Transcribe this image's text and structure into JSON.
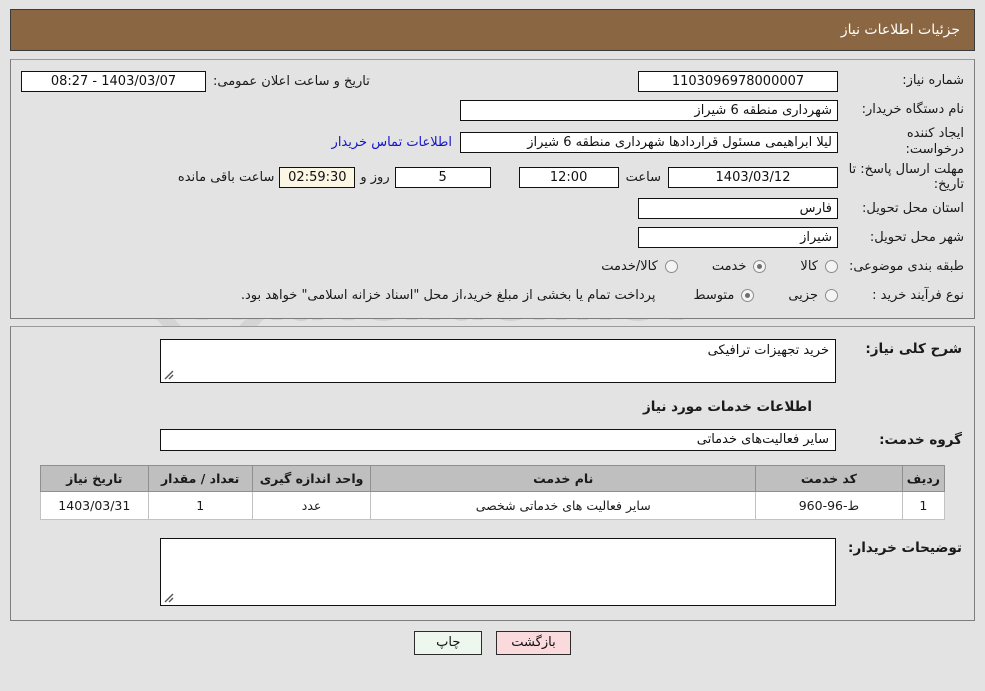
{
  "header": {
    "title": "جزئیات اطلاعات نیاز"
  },
  "watermark": {
    "text": "AnaTender.net"
  },
  "top_form": {
    "need_number": {
      "label": "شماره نیاز:",
      "value": "1103096978000007"
    },
    "public_announce": {
      "label": "تاریخ و ساعت اعلان عمومی:",
      "value": "1403/03/07 - 08:27"
    },
    "buyer_org": {
      "label": "نام دستگاه خریدار:",
      "value": "شهرداری منطقه 6 شیراز"
    },
    "request_creator": {
      "label": "ایجاد کننده درخواست:",
      "value": "لیلا ابراهیمی مسئول قراردادها شهرداری منطقه 6 شیراز"
    },
    "contact_link": "اطلاعات تماس خریدار",
    "deadline": {
      "label": "مهلت ارسال پاسخ: تا تاریخ:",
      "date": "1403/03/12",
      "time_label": "ساعت",
      "time": "12:00",
      "days": "5",
      "days_label": "روز و",
      "countdown": "02:59:30",
      "countdown_label": "ساعت باقی مانده"
    },
    "province": {
      "label": "استان محل تحویل:",
      "value": "فارس"
    },
    "city": {
      "label": "شهر محل تحویل:",
      "value": "شیراز"
    },
    "category": {
      "label": "طبقه بندی موضوعی:",
      "options": [
        {
          "label": "کالا",
          "selected": false
        },
        {
          "label": "خدمت",
          "selected": true
        },
        {
          "label": "کالا/خدمت",
          "selected": false
        }
      ]
    },
    "process_type": {
      "label": "نوع فرآیند خرید :",
      "options": [
        {
          "label": "جزیی",
          "selected": false
        },
        {
          "label": "متوسط",
          "selected": true
        }
      ],
      "note": "پرداخت تمام یا بخشی از مبلغ خرید،از محل \"اسناد خزانه اسلامی\" خواهد بود."
    }
  },
  "middle": {
    "general_desc": {
      "label": "شرح کلی نیاز:",
      "value": "خرید تجهیزات ترافیکی"
    },
    "services_section_title": "اطلاعات خدمات مورد نیاز",
    "service_group": {
      "label": "گروه خدمت:",
      "value": "سایر فعالیت‌های خدماتی"
    },
    "table": {
      "columns": [
        "ردیف",
        "کد خدمت",
        "نام خدمت",
        "واحد اندازه گیری",
        "تعداد / مقدار",
        "تاریخ نیاز"
      ],
      "rows": [
        {
          "radif": "1",
          "code": "ط-96-960",
          "name": "سایر فعالیت های خدماتی شخصی",
          "unit": "عدد",
          "qty": "1",
          "date": "1403/03/31"
        }
      ]
    },
    "buyer_comments": {
      "label": "توضیحات خریدار:",
      "value": ""
    }
  },
  "footer": {
    "print_label": "چاپ",
    "back_label": "بازگشت"
  },
  "colors": {
    "titlebar": "#8a6742",
    "link": "#1414cc",
    "table_header": "#bfbfbf",
    "print_button": "#edf7ed",
    "back_button": "#fadadd",
    "countdown_bg": "#fbf7e4"
  }
}
